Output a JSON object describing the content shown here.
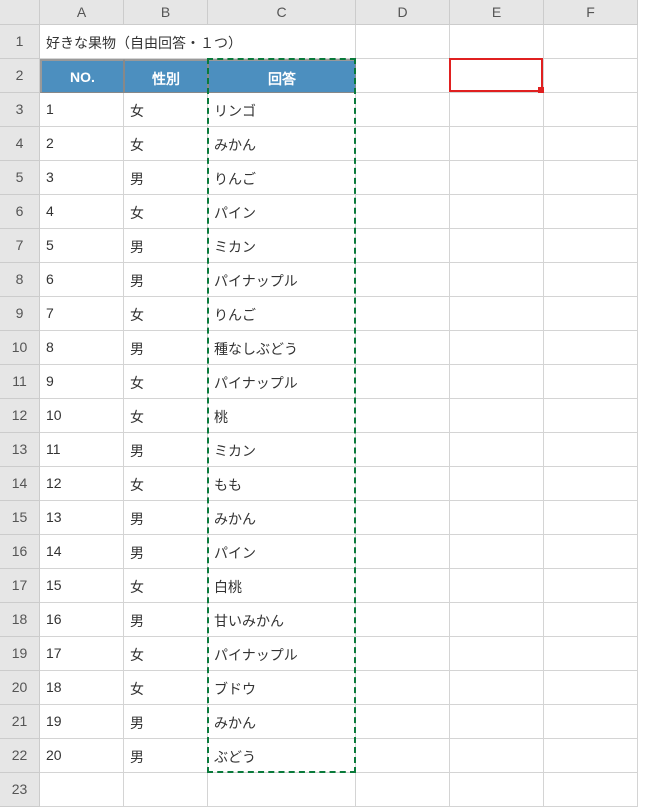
{
  "colHeaders": [
    "A",
    "B",
    "C",
    "D",
    "E",
    "F"
  ],
  "titleRow": {
    "text": "好きな果物（自由回答・１つ）"
  },
  "tableHeaders": {
    "no": "NO.",
    "gender": "性別",
    "answer": "回答"
  },
  "rows": [
    {
      "no": 1,
      "gender": "女",
      "answer": "リンゴ"
    },
    {
      "no": 2,
      "gender": "女",
      "answer": "みかん"
    },
    {
      "no": 3,
      "gender": "男",
      "answer": "りんご"
    },
    {
      "no": 4,
      "gender": "女",
      "answer": "パイン"
    },
    {
      "no": 5,
      "gender": "男",
      "answer": "ミカン"
    },
    {
      "no": 6,
      "gender": "男",
      "answer": "パイナップル"
    },
    {
      "no": 7,
      "gender": "女",
      "answer": "りんご"
    },
    {
      "no": 8,
      "gender": "男",
      "answer": "種なしぶどう"
    },
    {
      "no": 9,
      "gender": "女",
      "answer": "パイナップル"
    },
    {
      "no": 10,
      "gender": "女",
      "answer": "桃"
    },
    {
      "no": 11,
      "gender": "男",
      "answer": "ミカン"
    },
    {
      "no": 12,
      "gender": "女",
      "answer": "もも"
    },
    {
      "no": 13,
      "gender": "男",
      "answer": "みかん"
    },
    {
      "no": 14,
      "gender": "男",
      "answer": "パイン"
    },
    {
      "no": 15,
      "gender": "女",
      "answer": "白桃"
    },
    {
      "no": 16,
      "gender": "男",
      "answer": "甘いみかん"
    },
    {
      "no": 17,
      "gender": "女",
      "answer": "パイナップル"
    },
    {
      "no": 18,
      "gender": "女",
      "answer": "ブドウ"
    },
    {
      "no": 19,
      "gender": "男",
      "answer": "みかん"
    },
    {
      "no": 20,
      "gender": "男",
      "answer": "ぶどう"
    }
  ],
  "selection": {
    "cell": "E2"
  },
  "marqueeRange": "C2:C22"
}
